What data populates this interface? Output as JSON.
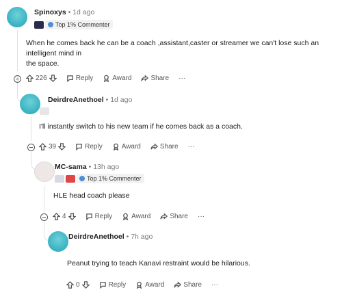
{
  "comments": [
    {
      "username": "Spinoxys",
      "time": " • 1d ago",
      "flair": "Top 1% Commenter",
      "text_line1": "When he comes back he can be a coach ,assistant,caster or streamer we can't lose such an intelligent mind in",
      "text_line2": "the space.",
      "votes": "226",
      "reply_label": "Reply",
      "award_label": "Award",
      "share_label": "Share",
      "more_label": "···"
    },
    {
      "username": "DeirdreAnethoel",
      "time": " • 1d ago",
      "text": "I'll instantly switch to his new team if he comes back as a coach.",
      "votes": "39",
      "reply_label": "Reply",
      "award_label": "Award",
      "share_label": "Share",
      "more_label": "···"
    },
    {
      "username": "MC-sama",
      "time": " • 13h ago",
      "flair": "Top 1% Commenter",
      "text": "HLE head coach please",
      "votes": "4",
      "reply_label": "Reply",
      "award_label": "Award",
      "share_label": "Share",
      "more_label": "···"
    },
    {
      "username": "DeirdreAnethoel",
      "time": " • 7h ago",
      "text": "Peanut trying to teach Kanavi restraint would be hilarious.",
      "votes": "0",
      "reply_label": "Reply",
      "award_label": "Award",
      "share_label": "Share",
      "more_label": "···"
    }
  ]
}
